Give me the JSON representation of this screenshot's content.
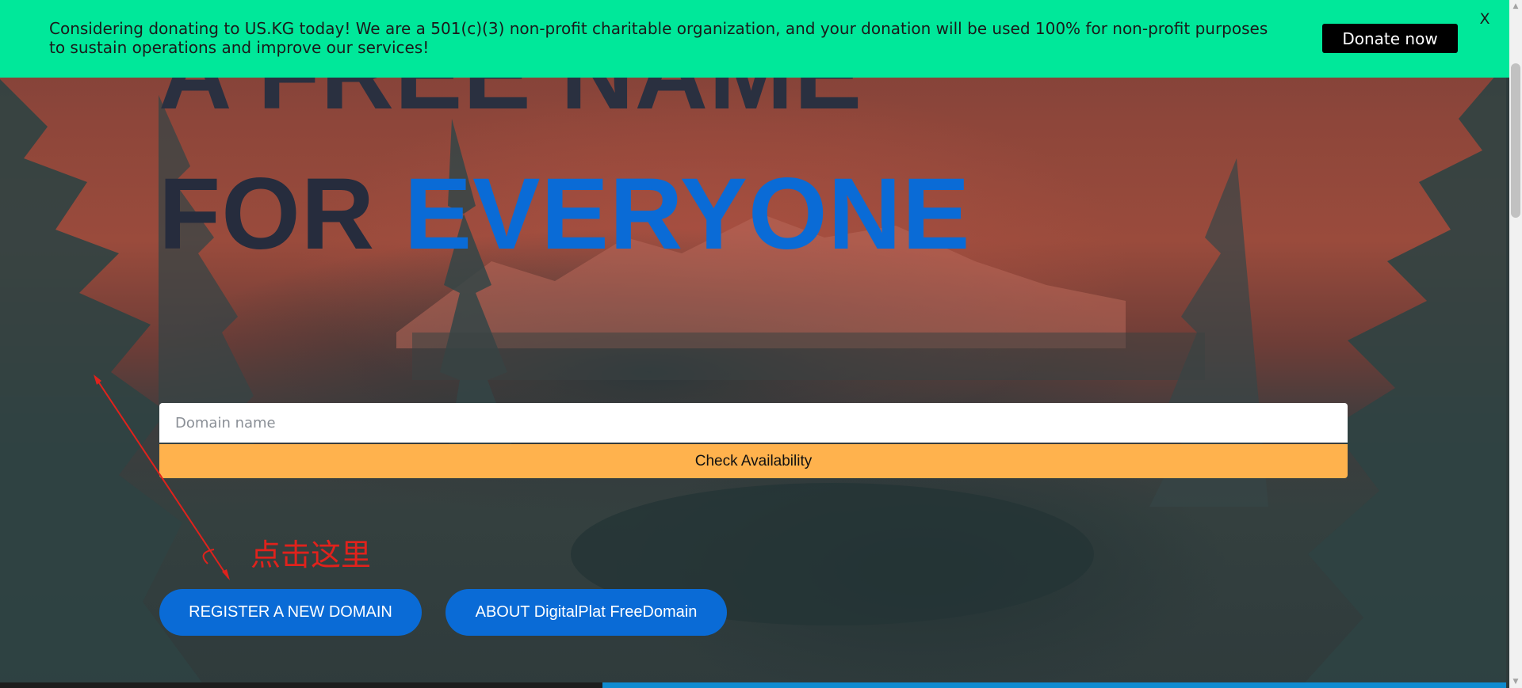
{
  "banner": {
    "message": "Considering donating to US.KG today! We are a 501(c)(3) non-profit charitable organization, and your donation will be used 100% for non-profit purposes to sustain operations and improve our services!",
    "donate_label": "Donate now",
    "close_label": "X"
  },
  "hero": {
    "headline_line1": "A FREE NAME",
    "headline_line2_prefix": "FOR ",
    "headline_line2_accent": "EVERYONE"
  },
  "search": {
    "placeholder": "Domain name",
    "value": "",
    "check_label": "Check Availability"
  },
  "annotation": {
    "text": "点击这里"
  },
  "actions": {
    "register_label": "REGISTER A NEW DOMAIN",
    "about_label": "ABOUT DigitalPlat FreeDomain"
  },
  "colors": {
    "banner_bg": "#00e89a",
    "accent_blue": "#0a6bd6",
    "check_button_bg": "#ffb24d",
    "annotation_red": "#e0221c",
    "donate_button_bg": "#000000"
  }
}
